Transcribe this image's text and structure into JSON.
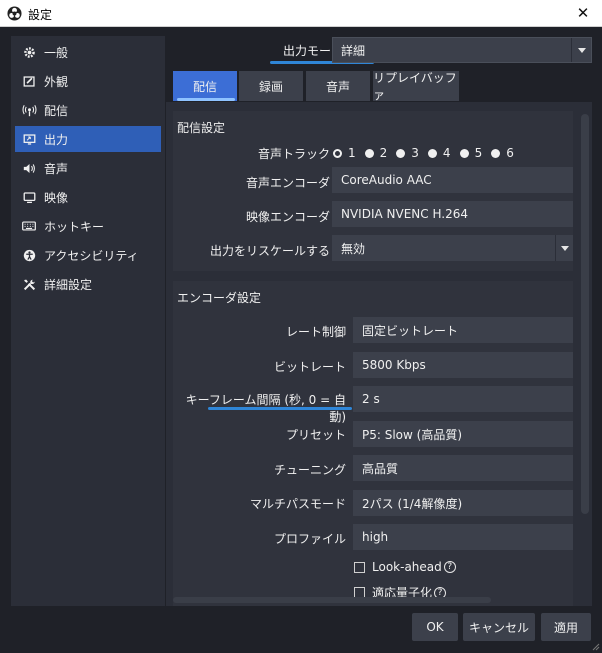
{
  "window": {
    "title": "設定",
    "close_label": "✕"
  },
  "sidebar": {
    "items": [
      {
        "label": "一般",
        "icon": "gear-icon"
      },
      {
        "label": "外観",
        "icon": "appearance-icon"
      },
      {
        "label": "配信",
        "icon": "broadcast-icon"
      },
      {
        "label": "出力",
        "icon": "output-icon"
      },
      {
        "label": "音声",
        "icon": "speaker-icon"
      },
      {
        "label": "映像",
        "icon": "monitor-icon"
      },
      {
        "label": "ホットキー",
        "icon": "keyboard-icon"
      },
      {
        "label": "アクセシビリティ",
        "icon": "accessibility-icon"
      },
      {
        "label": "詳細設定",
        "icon": "tools-icon"
      }
    ],
    "active_index": 3
  },
  "output_mode": {
    "label": "出力モード",
    "value": "詳細"
  },
  "tabs": [
    {
      "label": "配信"
    },
    {
      "label": "録画"
    },
    {
      "label": "音声"
    },
    {
      "label": "リプレイバッファ"
    }
  ],
  "stream_settings": {
    "title": "配信設定",
    "audio_track_label": "音声トラック",
    "tracks": [
      "1",
      "2",
      "3",
      "4",
      "5",
      "6"
    ],
    "audio_encoder_label": "音声エンコーダ",
    "audio_encoder_value": "CoreAudio AAC",
    "video_encoder_label": "映像エンコーダ",
    "video_encoder_value": "NVIDIA NVENC H.264",
    "rescale_label": "出力をリスケールする",
    "rescale_value": "無効"
  },
  "encoder_settings": {
    "title": "エンコーダ設定",
    "rate_control_label": "レート制御",
    "rate_control_value": "固定ビットレート",
    "bitrate_label": "ビットレート",
    "bitrate_value": "5800 Kbps",
    "keyframe_label": "キーフレーム間隔 (秒, 0 = 自動)",
    "keyframe_value": "2 s",
    "preset_label": "プリセット",
    "preset_value": "P5: Slow (高品質)",
    "tuning_label": "チューニング",
    "tuning_value": "高品質",
    "multipass_label": "マルチパスモード",
    "multipass_value": "2パス (1/4解像度)",
    "profile_label": "プロファイル",
    "profile_value": "high",
    "lookahead_label": "Look-ahead",
    "adaptive_label": "適応量子化",
    "help_glyph": "?"
  },
  "buttons": {
    "ok": "OK",
    "cancel": "キャンセル",
    "apply": "適用"
  }
}
